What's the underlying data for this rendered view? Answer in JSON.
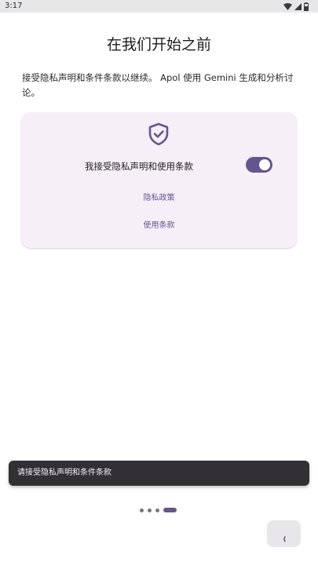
{
  "status_bar": {
    "time": "3:17",
    "icons": [
      "wifi-icon",
      "signal-icon",
      "battery-icon"
    ]
  },
  "header": {
    "title": "在我们开始之前"
  },
  "intro": {
    "text": "接受隐私声明和条件条款以继续。 Apol 使用 Gemini 生成和分析讨论。"
  },
  "consent_card": {
    "icon": "shield-check-icon",
    "label": "我接受隐私声明和使用条款",
    "toggle_on": true,
    "privacy_policy_link": "隐私政策",
    "terms_link": "使用条款"
  },
  "snackbar": {
    "message": "请接受隐私声明和条件条款"
  },
  "pagination": {
    "total": 4,
    "current": 4
  },
  "colors": {
    "accent": "#65558f",
    "card_bg": "#f6eff8",
    "snackbar_bg": "#322f35",
    "status_bar_bg": "#e7e7e9"
  }
}
